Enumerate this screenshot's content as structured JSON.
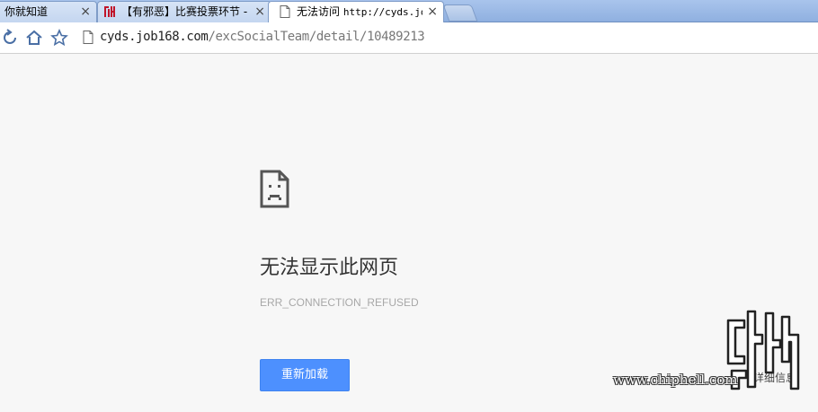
{
  "tabs": [
    {
      "title": "你就知道",
      "icon": "none"
    },
    {
      "title": "【有邪恶】比赛投票环节 -",
      "icon": "chiphell-icon"
    },
    {
      "title_prefix": "无法访问 ",
      "title_url": "http://cyds.jo",
      "icon": "page-icon",
      "active": true
    }
  ],
  "toolbar": {
    "url_host": "cyds.job168.com",
    "url_path": "/excSocialTeam/detail/10489213"
  },
  "error": {
    "title": "无法显示此网页",
    "code": "ERR_CONNECTION_REFUSED",
    "reload_label": "重新加载",
    "details_label": "详细信息"
  },
  "watermark": {
    "site": "www.chiphell.com"
  },
  "colors": {
    "tab_strip": "#a9c4ec",
    "page_background": "#f7f7f7",
    "button_blue": "#4d90fe",
    "logo_red": "#c0142a"
  }
}
